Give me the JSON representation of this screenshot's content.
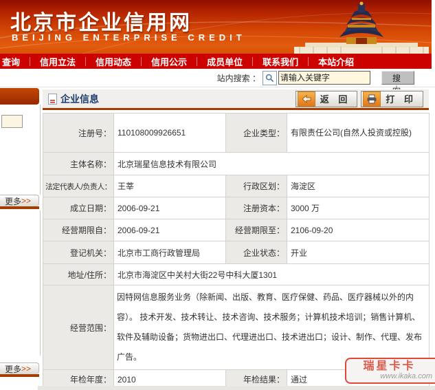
{
  "brand": {
    "title": "北京市企业信用网",
    "subtitle": "BEIJING   ENTERPRISE   CREDIT"
  },
  "nav": {
    "items": [
      "查询",
      "信用立法",
      "信用动态",
      "信用公示",
      "成员单位",
      "联系我们",
      "本站介绍"
    ]
  },
  "search": {
    "label": "站内搜索 ：",
    "placeholder": "请输入关键字",
    "button": "搜 索"
  },
  "sidebar": {
    "more_top": "更多",
    "more_top_arrow": ">>",
    "more_bottom": "更多",
    "more_bottom_arrow": ">>"
  },
  "content": {
    "title": "企业信息",
    "back_button": "返 回",
    "print_button": "打 印"
  },
  "record": {
    "reg_no_label": "注册号：",
    "reg_no": "110108009926651",
    "type_label": "企业类型：",
    "type": "有限责任公司(自然人投资或控股)",
    "name_label": "主体名称：",
    "name": "北京瑞星信息技术有限公司",
    "legal_label": "法定代表人/负责人：",
    "legal": "王莘",
    "district_label": "行政区划：",
    "district": "海淀区",
    "est_date_label": "成立日期：",
    "est_date": "2006-09-21",
    "capital_label": "注册资本：",
    "capital": "3000 万",
    "term_from_label": "经营期限自：",
    "term_from": "2006-09-21",
    "term_to_label": "经营期限至：",
    "term_to": "2106-09-20",
    "authority_label": "登记机关：",
    "authority": "北京市工商行政管理局",
    "status_label": "企业状态：",
    "status": "开业",
    "address_label": "地址/住所：",
    "address": "北京市海淀区中关村大街22号中科大厦1301",
    "scope_label": "经营范围：",
    "scope": "因特网信息服务业务（除新闻、出版、教育、医疗保健、药品、医疗器械以外的内容）。 技术开发、技术转让、技术咨询、技术服务；计算机技术培训；销售计算机、软件及辅助设备；货物进出口、代理进出口、技术进出口；设计、制作、代理、发布广告。",
    "annual_year_label": "年检年度：",
    "annual_year": "2010",
    "annual_result_label": "年检结果：",
    "annual_result": "通过"
  },
  "watermark": {
    "text": "瑞星卡卡",
    "url": "www.ikaka.com"
  },
  "colors": {
    "nav_red": "#cc0201",
    "banner_top": "#8e0e00",
    "banner_bottom": "#e25c0e",
    "divider_orange": "#a33e03",
    "title_navy": "#1c3d6e",
    "label_bg": "#eceae6",
    "input_bg": "#fff8df",
    "watermark_red": "#e0483a"
  }
}
